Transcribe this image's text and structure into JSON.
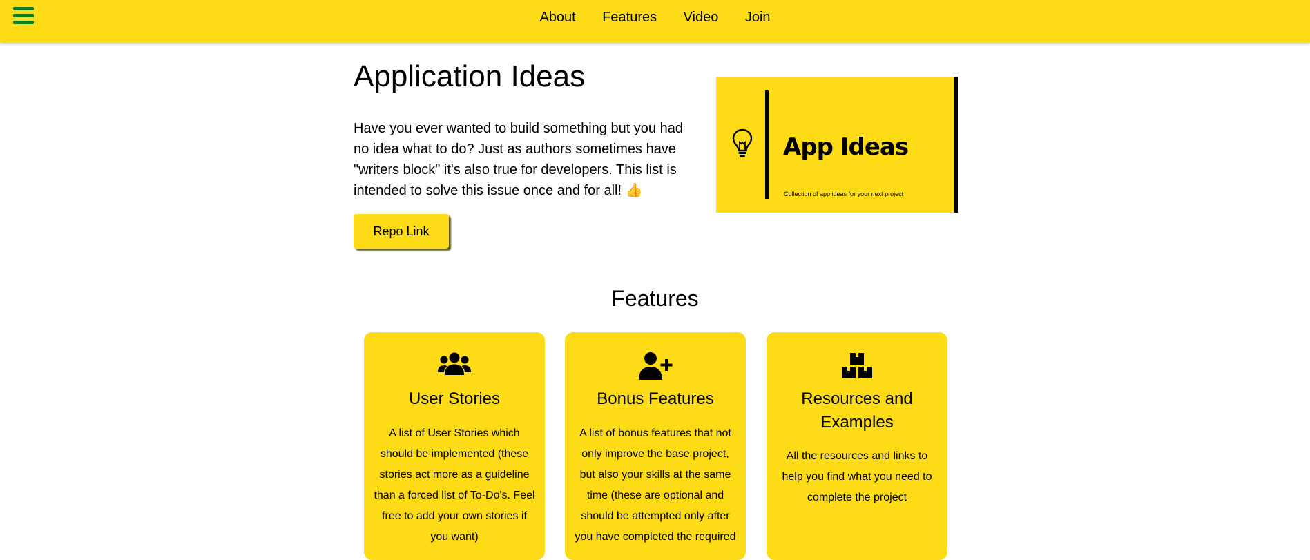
{
  "nav": {
    "links": [
      {
        "label": "About"
      },
      {
        "label": "Features"
      },
      {
        "label": "Video"
      },
      {
        "label": "Join"
      }
    ]
  },
  "hero": {
    "title": "Application Ideas",
    "description": "Have you ever wanted to build something but you had no idea what to do? Just as authors sometimes have \"writers block\" it's also true for developers. This list is intended to solve this issue once and for all! 👍",
    "button_label": "Repo Link"
  },
  "banner": {
    "title": "App Ideas",
    "subtitle": "Collection of app ideas for your next project",
    "icon": "lightbulb-icon"
  },
  "features": {
    "heading": "Features",
    "cards": [
      {
        "icon": "users-icon",
        "title": "User Stories",
        "description": "A list of User Stories which should be implemented (these stories act more as a guideline than a forced list of To-Do's. Feel free to add your own stories if you want)"
      },
      {
        "icon": "user-plus-icon",
        "title": "Bonus Features",
        "description": "A list of bonus features that not only improve the base project, but also your skills at the same time (these are optional and should be attempted only after you have completed the required"
      },
      {
        "icon": "boxes-icon",
        "title": "Resources and Examples",
        "description": "All the resources and links to help you find what you need to complete the project"
      }
    ]
  },
  "colors": {
    "accent": "#fddb17",
    "menu_icon": "#0f7a16",
    "text": "#000000"
  }
}
